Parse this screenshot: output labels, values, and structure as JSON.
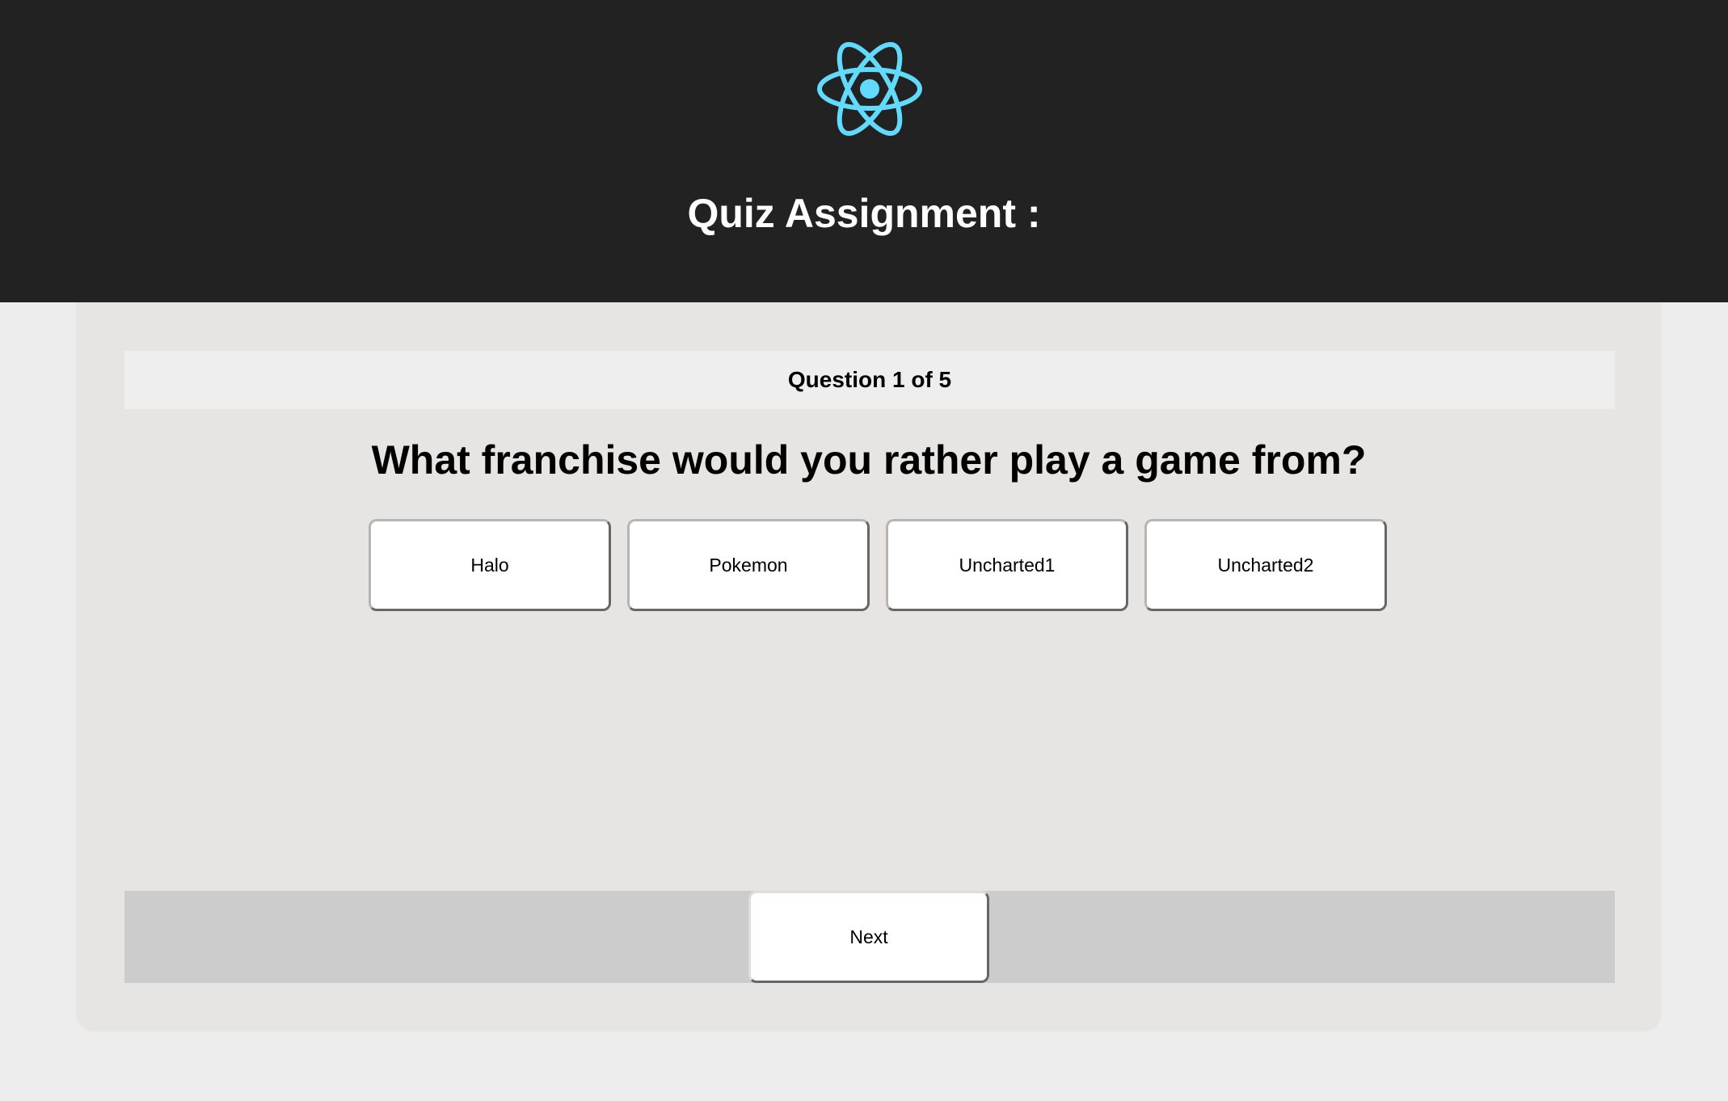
{
  "header": {
    "logo_icon": "react-atom-icon",
    "logo_color": "#61dafb",
    "title": "Quiz Assignment :"
  },
  "quiz": {
    "counter": "Question 1 of 5",
    "question": "What franchise would you rather play a game from?",
    "options": [
      {
        "label": "Halo"
      },
      {
        "label": "Pokemon"
      },
      {
        "label": "Uncharted1"
      },
      {
        "label": "Uncharted2"
      }
    ],
    "next_label": "Next"
  },
  "colors": {
    "header_bg": "#222222",
    "page_bg": "#ededed",
    "card_bg": "#e6e5e3",
    "footer_bg": "#cccccc"
  }
}
